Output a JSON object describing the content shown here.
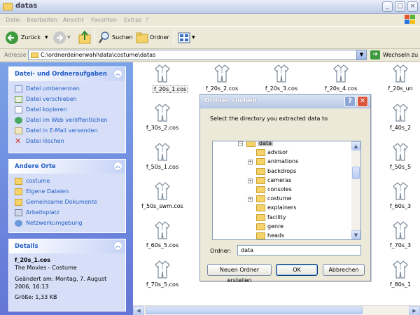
{
  "window": {
    "title": "datas",
    "controls": [
      "_",
      "□",
      "×"
    ]
  },
  "menu": [
    "Datei",
    "Bearbeiten",
    "Ansicht",
    "Favoriten",
    "Extras",
    "?"
  ],
  "toolbar": {
    "back_label": "Zurück",
    "search_label": "Suchen",
    "folders_label": "Ordner"
  },
  "address": {
    "label": "Adresse",
    "path": "C:\\ordnerdeinerwahl\\data\\costume\\datas",
    "go_label": "Wechseln zu"
  },
  "tasks": {
    "title": "Datei- und Ordneraufgaben",
    "items": [
      {
        "label": "Datei umbenennen",
        "icon": "rename-icon"
      },
      {
        "label": "Datei verschieben",
        "icon": "move-icon"
      },
      {
        "label": "Datei kopieren",
        "icon": "copy-icon"
      },
      {
        "label": "Datei im Web veröffentlichen",
        "icon": "web-publish-icon"
      },
      {
        "label": "Datei in E-Mail versenden",
        "icon": "email-icon"
      },
      {
        "label": "Datei löschen",
        "icon": "delete-icon"
      }
    ]
  },
  "places": {
    "title": "Andere Orte",
    "items": [
      {
        "label": "costume",
        "icon": "folder-icon"
      },
      {
        "label": "Eigene Dateien",
        "icon": "my-documents-icon"
      },
      {
        "label": "Gemeinsame Dokumente",
        "icon": "shared-documents-icon"
      },
      {
        "label": "Arbeitsplatz",
        "icon": "my-computer-icon"
      },
      {
        "label": "Netzwerkumgebung",
        "icon": "network-icon"
      }
    ]
  },
  "details": {
    "title": "Details",
    "filename": "f_20s_1.cos",
    "type": "The Movies - Costume",
    "modified": "Geändert am: Montag, 7. August 2006, 16:13",
    "size": "Größe: 1,33 KB"
  },
  "files": [
    [
      "f_20s_1.cos",
      "f_20s_2.cos",
      "f_20s_3.cos",
      "f_20s_4.cos",
      "f_20s_un"
    ],
    [
      "f_30s_2.cos",
      "",
      "",
      "",
      "f_40s_2"
    ],
    [
      "f_50s_1.cos",
      "",
      "",
      "",
      "f_50s_5"
    ],
    [
      "f_50s_swm.cos",
      "",
      "",
      "",
      "f_60s_3"
    ],
    [
      "f_60s_5.cos",
      "",
      "",
      "",
      "f_70s_3"
    ],
    [
      "f_70s_5.cos",
      "",
      "",
      "",
      "f_80s_1"
    ]
  ],
  "dialog": {
    "title": "Ordner suchen",
    "prompt": "Select the directory you extracted data to",
    "tree": [
      {
        "label": "data",
        "expanded": true,
        "selected": true,
        "level": 0
      },
      {
        "label": "advisor",
        "level": 1
      },
      {
        "label": "animations",
        "level": 1,
        "expandable": true
      },
      {
        "label": "backdrops",
        "level": 1
      },
      {
        "label": "cameras",
        "level": 1,
        "expandable": true
      },
      {
        "label": "consoles",
        "level": 1
      },
      {
        "label": "costume",
        "level": 1,
        "expandable": true
      },
      {
        "label": "explainers",
        "level": 1
      },
      {
        "label": "facility",
        "level": 1
      },
      {
        "label": "genre",
        "level": 1
      },
      {
        "label": "heads",
        "level": 1
      }
    ],
    "folder_label": "Ordner:",
    "folder_value": "data",
    "new_folder_button": "Neuen Ordner erstellen",
    "ok_button": "OK",
    "cancel_button": "Abbrechen"
  }
}
